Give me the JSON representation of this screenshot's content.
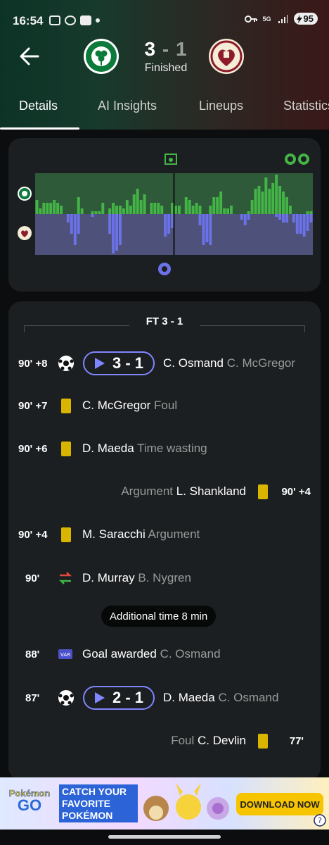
{
  "status_bar": {
    "time": "16:54",
    "battery": "95",
    "network": "5G"
  },
  "match": {
    "home_score": "3",
    "separator": "-",
    "away_score": "1",
    "status": "Finished",
    "home_team": "Celtic",
    "away_team": "Hearts"
  },
  "tabs": [
    {
      "label": "Details",
      "active": true
    },
    {
      "label": "AI Insights"
    },
    {
      "label": "Lineups"
    },
    {
      "label": "Statistics"
    }
  ],
  "momentum": {
    "home_color": "#44b447",
    "away_color": "#6b72e8",
    "home": [
      5,
      2,
      4,
      4,
      4,
      5,
      4,
      3,
      0,
      0,
      0,
      0,
      6,
      2,
      0,
      0,
      1,
      1,
      1,
      4,
      0,
      2,
      4,
      3,
      3,
      2,
      5,
      3,
      7,
      9,
      5,
      7,
      0,
      4,
      4,
      4,
      3,
      0,
      0,
      4,
      3,
      3,
      0,
      6,
      5,
      3,
      4,
      3,
      0,
      0,
      3,
      6,
      6,
      8,
      2,
      2,
      3,
      0,
      0,
      0,
      0,
      1,
      5,
      9,
      10,
      8,
      13,
      9,
      11,
      14,
      10,
      8,
      6,
      3,
      0,
      0,
      0,
      0,
      1,
      1
    ],
    "away": [
      0,
      0,
      0,
      0,
      0,
      0,
      0,
      0,
      0,
      3,
      7,
      11,
      7,
      0,
      0,
      0,
      1,
      0,
      0,
      0,
      0,
      7,
      14,
      13,
      11,
      0,
      0,
      0,
      0,
      0,
      0,
      0,
      0,
      0,
      0,
      0,
      0,
      8,
      7,
      5,
      0,
      0,
      0,
      0,
      0,
      0,
      0,
      4,
      11,
      10,
      11,
      0,
      0,
      0,
      0,
      0,
      0,
      0,
      0,
      2,
      4,
      2,
      0,
      0,
      0,
      0,
      0,
      0,
      0,
      1,
      2,
      3,
      3,
      0,
      3,
      7,
      7,
      8,
      6,
      3
    ]
  },
  "timeline": {
    "header": "FT 3 - 1",
    "events": [
      {
        "minute": "90' +8",
        "type": "goal",
        "score": "3 - 1",
        "player": "C. Osmand",
        "detail": "C. McGregor",
        "side": "home"
      },
      {
        "minute": "90' +7",
        "type": "yellow",
        "player": "C. McGregor",
        "detail": "Foul",
        "side": "home"
      },
      {
        "minute": "90' +6",
        "type": "yellow",
        "player": "D. Maeda",
        "detail": "Time wasting",
        "side": "home"
      },
      {
        "minute": "90' +4",
        "type": "yellow",
        "player": "L. Shankland",
        "detail": "Argument",
        "side": "away"
      },
      {
        "minute": "90' +4",
        "type": "yellow",
        "player": "M. Saracchi",
        "detail": "Argument",
        "side": "home"
      },
      {
        "minute": "90'",
        "type": "sub",
        "player": "D. Murray",
        "detail": "B. Nygren",
        "side": "home"
      },
      {
        "type": "info",
        "text": "Additional time 8 min"
      },
      {
        "minute": "88'",
        "type": "var",
        "player": "Goal awarded",
        "detail": "C. Osmand",
        "side": "home"
      },
      {
        "minute": "87'",
        "type": "goal",
        "score": "2 - 1",
        "player": "D. Maeda",
        "detail": "C. Osmand",
        "side": "home"
      },
      {
        "minute": "77'",
        "type": "yellow",
        "player": "C. Devlin",
        "detail": "Foul",
        "side": "away"
      }
    ]
  },
  "ad": {
    "logo_line1": "Pokémon",
    "logo_line2": "GO",
    "headline": "CATCH YOUR FAVORITE POKÉMON",
    "cta": "DOWNLOAD NOW"
  }
}
